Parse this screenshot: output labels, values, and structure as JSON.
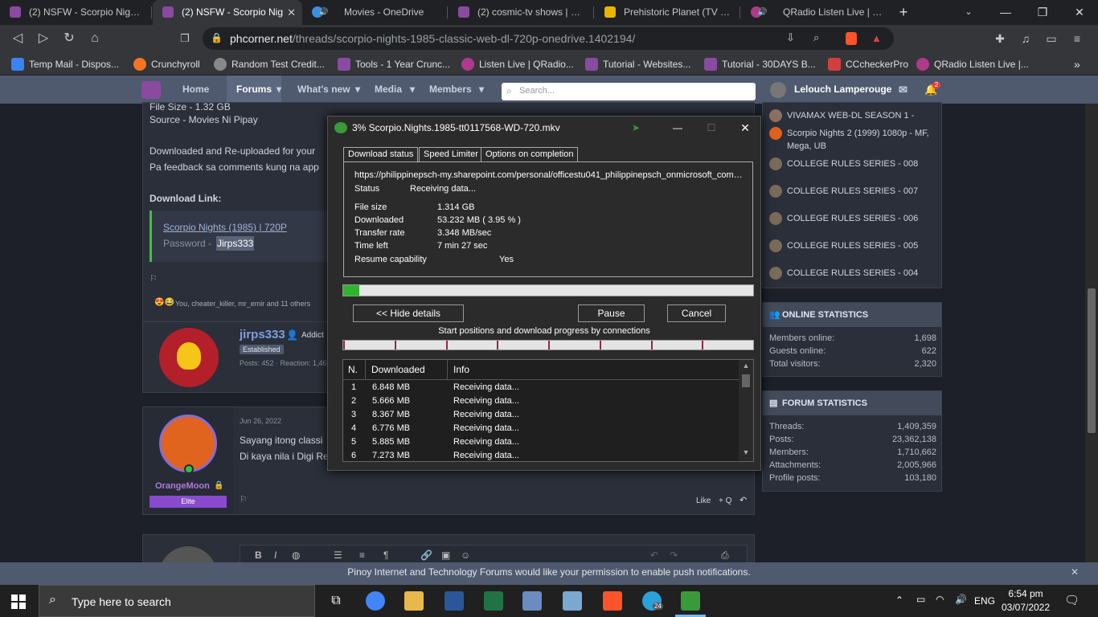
{
  "browser": {
    "tabs": [
      {
        "label": "(2) NSFW - Scorpio Nights (",
        "color": "#8a4aa0",
        "active": false
      },
      {
        "label": "(2) NSFW - Scorpio Nig",
        "color": "#8a4aa0",
        "active": true,
        "close": "✕"
      },
      {
        "label": "Movies - OneDrive",
        "color": "#3b8fe0",
        "active": false
      },
      {
        "label": "(2) cosmic-tv shows | Pinoy",
        "color": "#8a4aa0",
        "active": false
      },
      {
        "label": "Prehistoric Planet (TV Mini S",
        "color": "#e8b400",
        "active": false
      },
      {
        "label": "QRadio Listen Live | Rad",
        "color": "#b03a8a",
        "active": false
      }
    ],
    "new_tab": "+",
    "window": {
      "minimize": "—",
      "maximize": "❐",
      "close": "✕"
    },
    "url_host": "phcorner.net",
    "url_path": "/threads/scorpio-nights-1985-classic-web-dl-720p-onedrive.1402194/",
    "bookmarks": [
      {
        "label": "Temp Mail - Dispos...",
        "color": "#3b82f6"
      },
      {
        "label": "Crunchyroll",
        "color": "#f47521"
      },
      {
        "label": "Random Test Credit...",
        "color": "#999999"
      },
      {
        "label": "Tools - 1 Year Crunc...",
        "color": "#8a4aa0"
      },
      {
        "label": "Listen Live | QRadio...",
        "color": "#b03a8a"
      },
      {
        "label": "Tutorial - Websites...",
        "color": "#8a4aa0"
      },
      {
        "label": "Tutorial - 30DAYS B...",
        "color": "#8a4aa0"
      },
      {
        "label": "CCcheckerPro",
        "color": "#d04040"
      },
      {
        "label": "QRadio Listen Live |...",
        "color": "#b03a8a"
      }
    ],
    "bookmarks_more": "»"
  },
  "site": {
    "nav": [
      "Home",
      "Forums",
      "What's new",
      "Media",
      "Members"
    ],
    "search_placeholder": "Search...",
    "username": "Lelouch Lamperouge",
    "alert_count": "2"
  },
  "post": {
    "file_size_line": "File Size - 1.32 GB",
    "source": "Source - Movies Ni Pipay",
    "reupload": "Downloaded and Re-uploaded for your",
    "feedback": "Pa feedback sa comments kung na app",
    "download_label": "Download Link:",
    "link_text": "Scorpio Nights (1985) | 720P",
    "password_label": "Password -",
    "password_value": "Jirps333",
    "reactions": "You, cheater_killer, mr_emir and 11 others",
    "author_name": "jirps333",
    "author_role": "Addict",
    "author_badge": "Established",
    "author_stats": "Posts: 452 · Reaction: 1,46"
  },
  "reply": {
    "date": "Jun 26, 2022",
    "line1": "Sayang itong classi",
    "line2": "Di kaya nila i Digi Re",
    "user": "OrangeMoon",
    "rank": "Elite",
    "like": "Like",
    "quote": "+ Q"
  },
  "sidebar": {
    "threads": [
      "VIVAMAX WEB-DL SEASON 1 -",
      "Scorpio Nights 2 (1999) 1080p - MF, Mega, UB",
      "COLLEGE RULES SERIES - 008",
      "COLLEGE RULES SERIES - 007",
      "COLLEGE RULES SERIES - 006",
      "COLLEGE RULES SERIES - 005",
      "COLLEGE RULES SERIES - 004"
    ],
    "online_title": "ONLINE STATISTICS",
    "online": [
      {
        "k": "Members online:",
        "v": "1,698"
      },
      {
        "k": "Guests online:",
        "v": "622"
      },
      {
        "k": "Total visitors:",
        "v": "2,320"
      }
    ],
    "forum_title": "FORUM STATISTICS",
    "forum": [
      {
        "k": "Threads:",
        "v": "1,409,359"
      },
      {
        "k": "Posts:",
        "v": "23,362,138"
      },
      {
        "k": "Members:",
        "v": "1,710,662"
      },
      {
        "k": "Attachments:",
        "v": "2,005,966"
      },
      {
        "k": "Profile posts:",
        "v": "103,180"
      }
    ]
  },
  "push_notice": "Pinoy Internet and Technology Forums would like your permission to enable push notifications.",
  "dialog": {
    "title": "3% Scorpio.Nights.1985-tt0117568-WD-720.mkv",
    "tabs": [
      "Download status",
      "Speed Limiter",
      "Options on completion"
    ],
    "url": "https://philippinepsch-my.sharepoint.com/personal/officestu041_philippinepsch_onmicrosoft_com/_la",
    "status_label": "Status",
    "status_value": "Receiving data...",
    "file_size_label": "File size",
    "file_size_value": "1.314  GB",
    "downloaded_label": "Downloaded",
    "downloaded_value": "53.232  MB  ( 3.95 % )",
    "rate_label": "Transfer rate",
    "rate_value": "3.348  MB/sec",
    "time_label": "Time left",
    "time_value": "7 min 27 sec",
    "resume_label": "Resume capability",
    "resume_value": "Yes",
    "progress": 0.0395,
    "hide_button": "<< Hide details",
    "pause_button": "Pause",
    "cancel_button": "Cancel",
    "connections_label": "Start positions and download progress by connections",
    "columns": [
      "N.",
      "Downloaded",
      "Info"
    ],
    "connections": [
      {
        "n": "1",
        "dl": "6.848  MB",
        "info": "Receiving data..."
      },
      {
        "n": "2",
        "dl": "5.666  MB",
        "info": "Receiving data..."
      },
      {
        "n": "3",
        "dl": "8.367  MB",
        "info": "Receiving data..."
      },
      {
        "n": "4",
        "dl": "6.776  MB",
        "info": "Receiving data..."
      },
      {
        "n": "5",
        "dl": "5.885  MB",
        "info": "Receiving data..."
      },
      {
        "n": "6",
        "dl": "7.273  MB",
        "info": "Receiving data..."
      }
    ]
  },
  "taskbar": {
    "search_placeholder": "Type here to search",
    "language": "ENG",
    "time": "6:54 pm",
    "date": "03/07/2022",
    "telegram_badge": "24"
  }
}
